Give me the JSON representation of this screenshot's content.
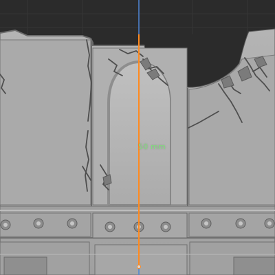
{
  "viewport": {
    "background": "#2b2b2b",
    "grid_color": "#3a3a3a",
    "model_color": "#a6a6a6",
    "x_axis_color": "#4f86d6",
    "measure_line_color": "#ff8a1f",
    "measure_text_color": "#7fe37a"
  },
  "measurement": {
    "label": "50 mm",
    "tool": "ruler-measure"
  },
  "model": {
    "name": "ruined-castle-wall-section",
    "features": [
      "arched-doorway",
      "crack-damage",
      "rivet-studs",
      "battlement-gap"
    ]
  }
}
